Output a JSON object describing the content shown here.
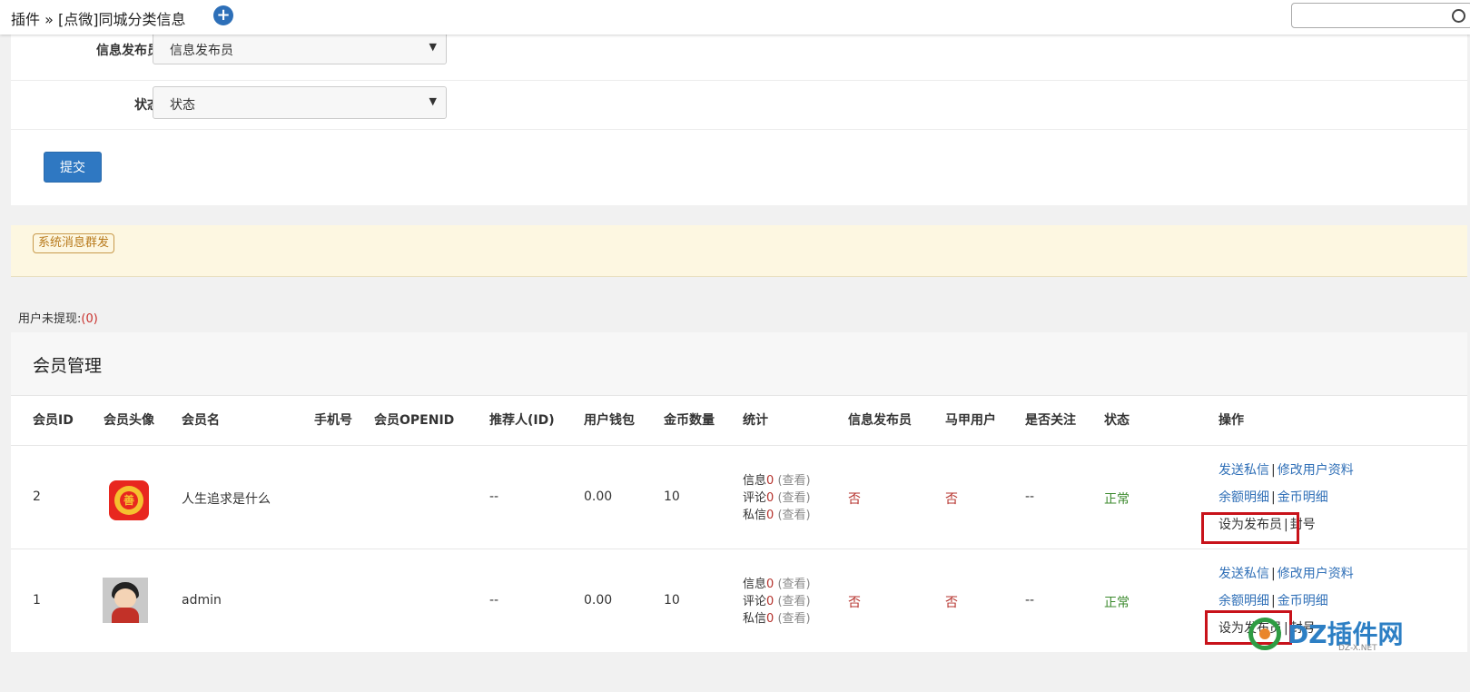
{
  "topbar": {
    "breadcrumb": "插件 » [点微]同城分类信息",
    "add_icon": "plus-circle-icon"
  },
  "form": {
    "publisher_label": "信息发布员",
    "publisher_value": "信息发布员",
    "status_label": "状态",
    "status_value": "状态",
    "submit_label": "提交"
  },
  "notice": {
    "broadcast_label": "系统消息群发"
  },
  "withdraw": {
    "label": "用户未提现:",
    "count": "(0)"
  },
  "members": {
    "title": "会员管理",
    "columns": [
      "会员ID",
      "会员头像",
      "会员名",
      "手机号",
      "会员OPENID",
      "推荐人(ID)",
      "用户钱包",
      "金币数量",
      "统计",
      "信息发布员",
      "马甲用户",
      "是否关注",
      "状态",
      "操作"
    ],
    "rows": [
      {
        "id": "2",
        "name": "人生追求是什么",
        "phone": "",
        "openid": "",
        "referrer": "--",
        "wallet": "0.00",
        "coins": "10",
        "stat_info_label": "信息",
        "stat_info": "0",
        "stat_comment_label": "评论",
        "stat_comment": "0",
        "stat_msg_label": "私信",
        "stat_msg": "0",
        "view": "(查看)",
        "publisher": "否",
        "vest": "否",
        "follow": "--",
        "status": "正常",
        "op_send": "发送私信",
        "op_edit": "修改用户资料",
        "op_balance": "余额明细",
        "op_coin": "金币明细",
        "op_set_pub": "设为发布员",
        "op_ban": "封号"
      },
      {
        "id": "1",
        "name": "admin",
        "phone": "",
        "openid": "",
        "referrer": "--",
        "wallet": "0.00",
        "coins": "10",
        "stat_info_label": "信息",
        "stat_info": "0",
        "stat_comment_label": "评论",
        "stat_comment": "0",
        "stat_msg_label": "私信",
        "stat_msg": "0",
        "view": "(查看)",
        "publisher": "否",
        "vest": "否",
        "follow": "--",
        "status": "正常",
        "op_send": "发送私信",
        "op_edit": "修改用户资料",
        "op_balance": "余额明细",
        "op_coin": "金币明细",
        "op_set_pub": "设为发布员",
        "op_ban": "封号"
      }
    ],
    "separator": "|"
  },
  "watermark": {
    "text": "DZ插件网",
    "sub": "DZ-X.NET"
  },
  "colors": {
    "primary": "#2f78c2",
    "danger": "#b5322c",
    "success": "#3c8a2e",
    "highlight": "#c8121a"
  }
}
